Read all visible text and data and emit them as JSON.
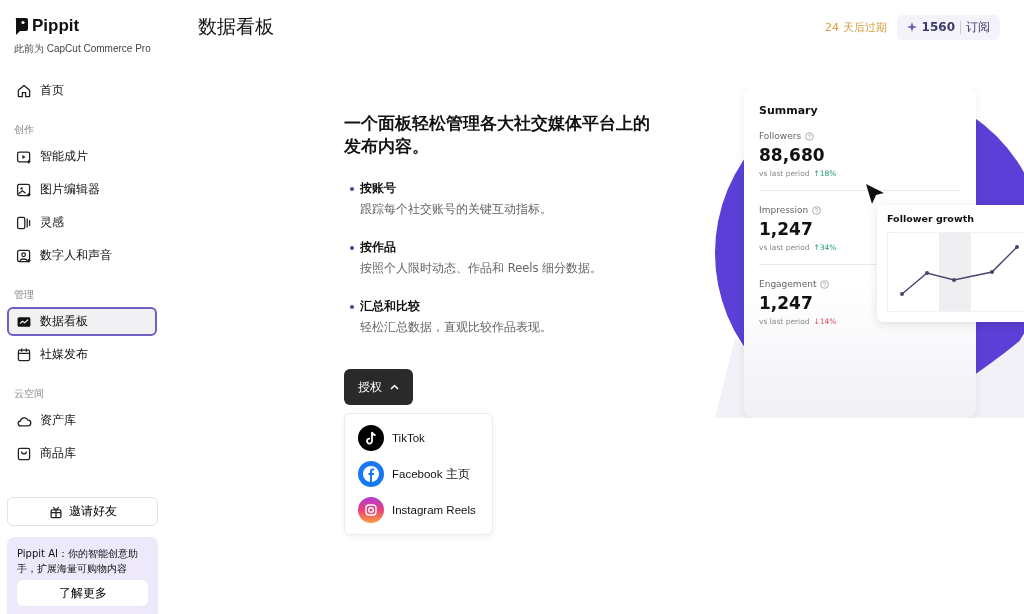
{
  "sidebar": {
    "logo": "Pippit",
    "subtitle": "此前为 CapCut Commerce Pro",
    "groups": [
      {
        "items": [
          {
            "label": "首页",
            "kind": "home",
            "selected": false
          }
        ]
      },
      {
        "title": "创作",
        "items": [
          {
            "label": "智能成片",
            "kind": "video",
            "selected": false
          },
          {
            "label": "图片编辑器",
            "kind": "image",
            "selected": false
          },
          {
            "label": "灵感",
            "kind": "cards",
            "selected": false
          },
          {
            "label": "数字人和声音",
            "kind": "avatar",
            "selected": false
          }
        ]
      },
      {
        "title": "管理",
        "items": [
          {
            "label": "数据看板",
            "kind": "chart",
            "selected": true
          },
          {
            "label": "社媒发布",
            "kind": "calendar",
            "selected": false
          }
        ]
      },
      {
        "title": "云空间",
        "items": [
          {
            "label": "资产库",
            "kind": "cloud",
            "selected": false
          },
          {
            "label": "商品库",
            "kind": "bag",
            "selected": false
          }
        ]
      }
    ],
    "invite_button": "邀请好友",
    "promo": {
      "text": "Pippit AI：你的智能创意助手，扩展海量可购物内容",
      "button": "了解更多"
    }
  },
  "header": {
    "title": "数据看板",
    "expiry": "24 天后过期",
    "credits": "1560",
    "subscribe": "订阅"
  },
  "intro": {
    "heading": "一个面板轻松管理各大社交媒体平台上的发布内容。",
    "features": [
      {
        "title": "按账号",
        "description": "跟踪每个社交账号的关键互动指标。"
      },
      {
        "title": "按作品",
        "description": "按照个人限时动态、作品和 Reels 细分数据。"
      },
      {
        "title": "汇总和比较",
        "description": "轻松汇总数据，直观比较作品表现。"
      }
    ]
  },
  "auth_menu": {
    "button": "授权",
    "expanded": true,
    "options": [
      {
        "label": "TikTok",
        "kind": "tiktok"
      },
      {
        "label": "Facebook 主页",
        "kind": "facebook"
      },
      {
        "label": "Instagram Reels",
        "kind": "instagram"
      }
    ]
  },
  "illustration": {
    "summary_title": "Summary",
    "metrics": [
      {
        "label": "Followers",
        "value": "88,680",
        "compare": "vs last period",
        "change": "↑18%",
        "kind": "up"
      },
      {
        "label": "Impression",
        "value": "1,247",
        "compare": "vs last period",
        "change": "↑34%",
        "kind": "up"
      },
      {
        "label": "Engagement",
        "value": "1,247",
        "compare": "vs last period",
        "change": "↓14%",
        "kind": "down"
      }
    ],
    "growth_title": "Follower growth"
  }
}
